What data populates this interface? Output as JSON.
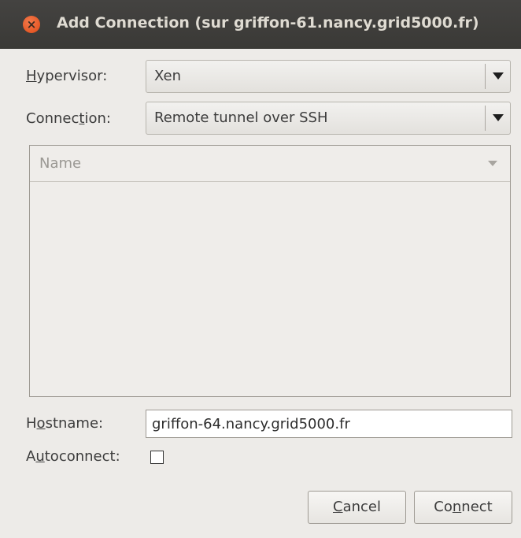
{
  "window": {
    "title": "Add Connection (sur griffon-61.nancy.grid5000.fr)",
    "close_glyph": "×"
  },
  "form": {
    "hypervisor": {
      "label_pre": "",
      "label_key": "H",
      "label_post": "ypervisor:",
      "value": "Xen"
    },
    "connection": {
      "label_pre": "Connec",
      "label_key": "t",
      "label_post": "ion:",
      "value": "Remote tunnel over SSH"
    },
    "list": {
      "header": "Name",
      "rows": []
    },
    "hostname": {
      "label_pre": "H",
      "label_key": "o",
      "label_post": "stname:",
      "value": "griffon-64.nancy.grid5000.fr"
    },
    "autoconnect": {
      "label_pre": "A",
      "label_key": "u",
      "label_post": "toconnect:",
      "checked": false
    }
  },
  "buttons": {
    "cancel": {
      "label_pre": "",
      "label_key": "C",
      "label_post": "ancel"
    },
    "connect": {
      "label_pre": "Co",
      "label_key": "n",
      "label_post": "nect"
    }
  },
  "icons": {
    "close": "close-icon",
    "combo_arrow": "chevron-down-icon",
    "sort_arrow": "sort-down-icon"
  },
  "colors": {
    "titlebar": "#3f3e3b",
    "close_button": "#e9572b",
    "background": "#edebe8"
  }
}
